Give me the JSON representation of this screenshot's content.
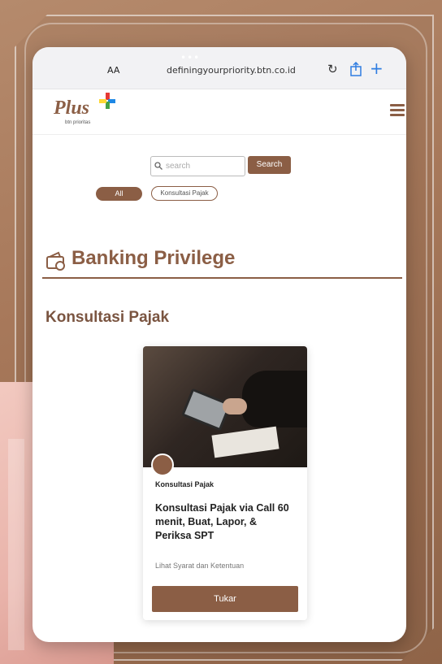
{
  "browser": {
    "text_size_label": "AA",
    "url": "definingyourpriority.btn.co.id"
  },
  "brand": {
    "logo_text": "Plus",
    "logo_sub": "btn prioritas",
    "accent": "#8b5e45"
  },
  "search": {
    "placeholder": "search",
    "button_label": "Search"
  },
  "filters": {
    "all_label": "All",
    "pajak_label": "Konsultasi Pajak"
  },
  "section": {
    "title": "Banking Privilege",
    "icon": "wallet-icon"
  },
  "category": {
    "title": "Konsultasi Pajak"
  },
  "card": {
    "category": "Konsultasi Pajak",
    "title": "Konsultasi Pajak via Call 60 menit, Buat, Lapor, & Periksa SPT",
    "terms": "Lihat Syarat dan Ketentuan",
    "button_label": "Tukar"
  }
}
